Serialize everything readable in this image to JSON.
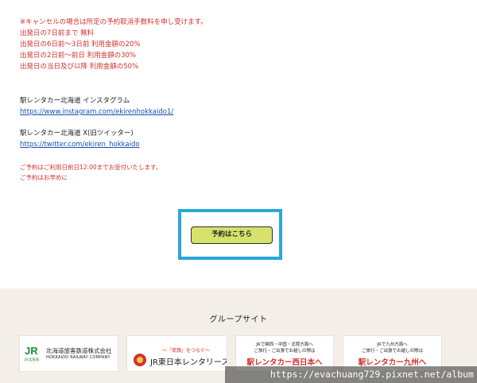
{
  "notice": {
    "lines": [
      "※キャンセルの場合は所定の予約取消手数料を申し受けます。",
      "出発日の7日前まで 無料",
      "出発日の6日前～3日前 利用金額の20%",
      "出発日の2日前～前日 利用金額の30%",
      "出発日の当日及び以降 利用金額の50%"
    ]
  },
  "instagram": {
    "title": "駅レンタカー北海道 インスタグラム",
    "url": "https://www.instagram.com/ekirenhokkaido1/"
  },
  "twitter": {
    "title": "駅レンタカー北海道 X(旧ツイッター)",
    "url": "https://twitter.com/ekiren_hokkaido"
  },
  "reservation_note": {
    "lines": [
      "ご予約はご利用日前日12:00までお受付いたします。",
      "ご予約はお早めに"
    ]
  },
  "cta": {
    "label": "予約はこちら"
  },
  "group_sites": {
    "title": "グループサイト",
    "banners": [
      {
        "logo": "JR",
        "logo_sub": "JR北海道",
        "title": "北海道旅客鉄道株式会社",
        "subtitle": "HOKKAIDO RAILWAY COMPANY"
      },
      {
        "tagline": "～「笑顔」をつなぐ～",
        "title": "JR東日本レンタリース"
      },
      {
        "line1": "JRで関西・中国・北陸方面へ",
        "line2": "ご旅行・ご出張でお越しの際は",
        "line3": "駅レンタカー西日本へ"
      },
      {
        "line1": "JRで九州方面へ",
        "line2": "ご旅行・ご出張でお越しの際は",
        "line3": "駅レンタカー九州へ"
      }
    ]
  },
  "watermark": "https://evachuang729.pixnet.net/album",
  "colors": {
    "notice_red": "#d2322d",
    "link_blue": "#1a4fb4",
    "cta_green": "#d6e26a",
    "cta_frame": "#2aa8d8",
    "footer_bg": "#f3efe8"
  }
}
